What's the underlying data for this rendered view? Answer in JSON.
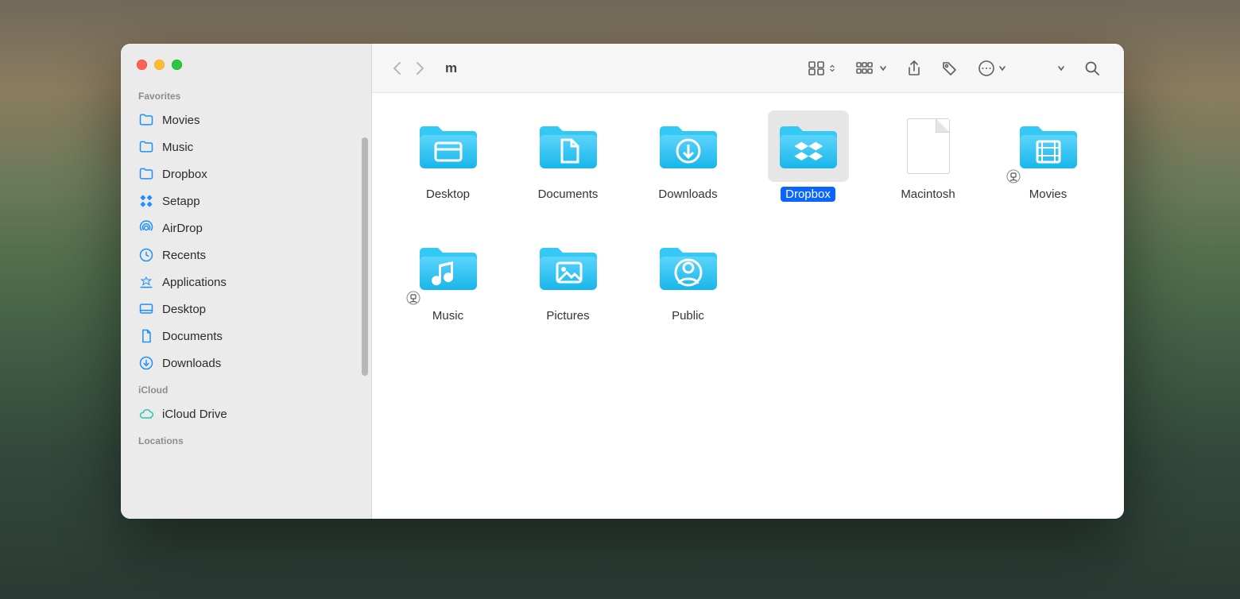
{
  "window": {
    "title": "m"
  },
  "sidebar": {
    "sections": [
      {
        "title": "Favorites",
        "items": [
          {
            "label": "Movies",
            "icon": "folder"
          },
          {
            "label": "Music",
            "icon": "folder"
          },
          {
            "label": "Dropbox",
            "icon": "folder"
          },
          {
            "label": "Setapp",
            "icon": "setapp"
          },
          {
            "label": "AirDrop",
            "icon": "airdrop"
          },
          {
            "label": "Recents",
            "icon": "clock"
          },
          {
            "label": "Applications",
            "icon": "apps"
          },
          {
            "label": "Desktop",
            "icon": "desktop"
          },
          {
            "label": "Documents",
            "icon": "document"
          },
          {
            "label": "Downloads",
            "icon": "download-circle"
          }
        ]
      },
      {
        "title": "iCloud",
        "items": [
          {
            "label": "iCloud Drive",
            "icon": "cloud"
          }
        ]
      },
      {
        "title": "Locations",
        "items": []
      }
    ]
  },
  "items": [
    {
      "label": "Desktop",
      "kind": "folder",
      "glyph": "window",
      "selected": false,
      "alias": false
    },
    {
      "label": "Documents",
      "kind": "folder",
      "glyph": "doc",
      "selected": false,
      "alias": false
    },
    {
      "label": "Downloads",
      "kind": "folder",
      "glyph": "download",
      "selected": false,
      "alias": false
    },
    {
      "label": "Dropbox",
      "kind": "folder",
      "glyph": "dropbox",
      "selected": true,
      "alias": false
    },
    {
      "label": "Macintosh",
      "kind": "file",
      "glyph": "blank",
      "selected": false,
      "alias": false
    },
    {
      "label": "Movies",
      "kind": "folder",
      "glyph": "film",
      "selected": false,
      "alias": true
    },
    {
      "label": "Music",
      "kind": "folder",
      "glyph": "music",
      "selected": false,
      "alias": true
    },
    {
      "label": "Pictures",
      "kind": "folder",
      "glyph": "image",
      "selected": false,
      "alias": false
    },
    {
      "label": "Public",
      "kind": "folder",
      "glyph": "person",
      "selected": false,
      "alias": false
    }
  ],
  "colors": {
    "folder": "#2fc3f2",
    "folderDark": "#12a8dd",
    "accent": "#0a65ff"
  }
}
